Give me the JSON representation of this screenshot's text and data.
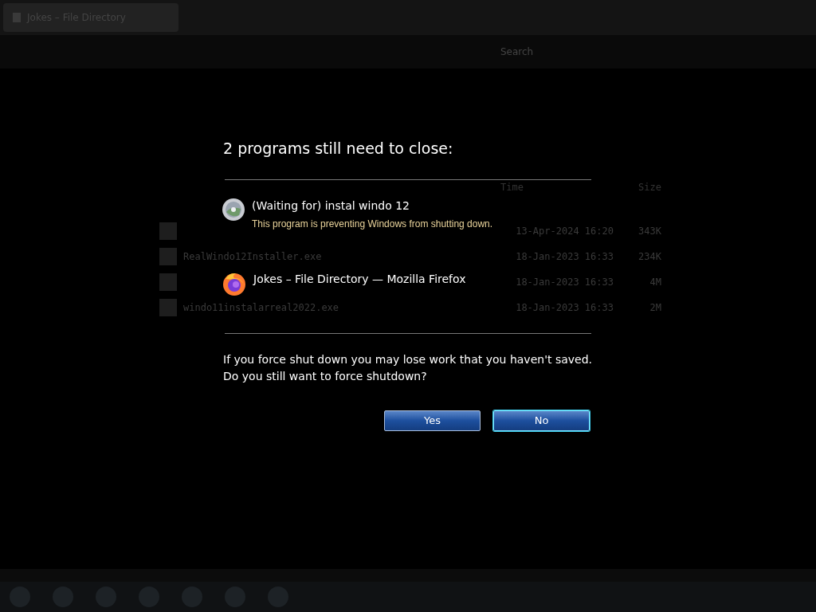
{
  "browser": {
    "tab": {
      "title": "Jokes – File Directory"
    },
    "search": {
      "placeholder": "Search"
    }
  },
  "listing": {
    "columns": [
      "Time",
      "Size"
    ],
    "rows": [
      {
        "date": "13-Apr-2024 16:20",
        "size": "343K"
      },
      {
        "name": "RealWindo12Installer.exe",
        "date": "18-Jan-2023 16:33",
        "size": "234K"
      },
      {
        "date": "18-Jan-2023 16:33",
        "size": "4M"
      },
      {
        "name": "windo11instalarreal2022.exe",
        "date": "18-Jan-2023 16:33",
        "size": "2M"
      }
    ]
  },
  "dialog": {
    "title": "2 programs still need to close:",
    "programs": [
      {
        "kind": "installer",
        "name": "(Waiting for) instal windo 12",
        "note": "This program is preventing Windows from shutting down."
      },
      {
        "kind": "browser",
        "name": "Jokes – File Directory — Mozilla Firefox"
      }
    ],
    "message": [
      "If you force shut down you may lose work that you haven't saved.",
      "Do you still want to force shutdown?"
    ],
    "buttons": [
      {
        "label": "Yes",
        "selected": false
      },
      {
        "label": "No",
        "selected": true
      }
    ]
  }
}
